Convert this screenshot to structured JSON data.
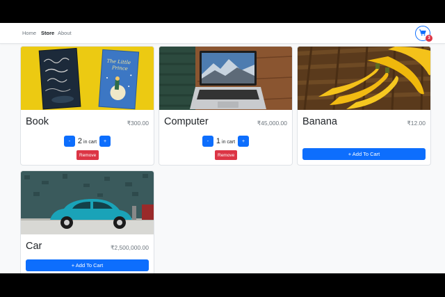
{
  "nav": {
    "links": [
      "Home",
      "Store",
      "About"
    ],
    "active": "Store",
    "cart_count": "3"
  },
  "products": [
    {
      "name": "Book",
      "price": "₹300.00",
      "quantity": "2",
      "in_cart_label": "in cart",
      "minus_label": "-",
      "plus_label": "+",
      "remove_label": "Remove"
    },
    {
      "name": "Computer",
      "price": "₹45,000.00",
      "quantity": "1",
      "in_cart_label": "in cart",
      "minus_label": "-",
      "plus_label": "+",
      "remove_label": "Remove"
    },
    {
      "name": "Banana",
      "price": "₹12.00",
      "add_label": "+ Add To Cart"
    },
    {
      "name": "Car",
      "price": "₹2,500,000.00",
      "add_label": "+ Add To Cart"
    }
  ],
  "colors": {
    "primary": "#0d6efd",
    "danger": "#dc3545",
    "background": "#f8f9fa"
  }
}
